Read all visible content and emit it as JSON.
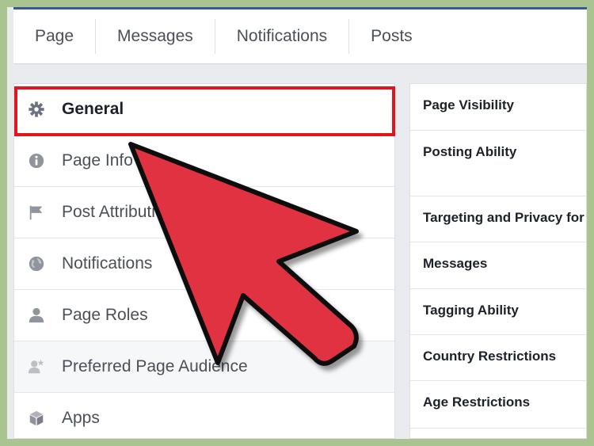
{
  "top_tabs": [
    {
      "label": "Page"
    },
    {
      "label": "Messages"
    },
    {
      "label": "Notifications"
    },
    {
      "label": "Posts"
    }
  ],
  "left_menu": [
    {
      "label": "General",
      "icon": "gear-icon",
      "active": true
    },
    {
      "label": "Page Info",
      "icon": "info-icon"
    },
    {
      "label": "Post Attribution",
      "icon": "flag-icon"
    },
    {
      "label": "Notifications",
      "icon": "globe-icon"
    },
    {
      "label": "Page Roles",
      "icon": "person-icon"
    },
    {
      "label": "Preferred Page Audience",
      "icon": "audience-icon"
    },
    {
      "label": "Apps",
      "icon": "cube-icon"
    }
  ],
  "right_settings": [
    {
      "label": "Page Visibility"
    },
    {
      "label": "Posting Ability"
    },
    {
      "label": "Targeting and Privacy for Posts"
    },
    {
      "label": "Messages"
    },
    {
      "label": "Tagging Ability"
    },
    {
      "label": "Country Restrictions"
    },
    {
      "label": "Age Restrictions"
    }
  ],
  "colors": {
    "frame_green": "#a9c391",
    "highlight_red": "#e0151d",
    "arrow_red": "#e0313f",
    "brand_blue": "#3b5998"
  }
}
